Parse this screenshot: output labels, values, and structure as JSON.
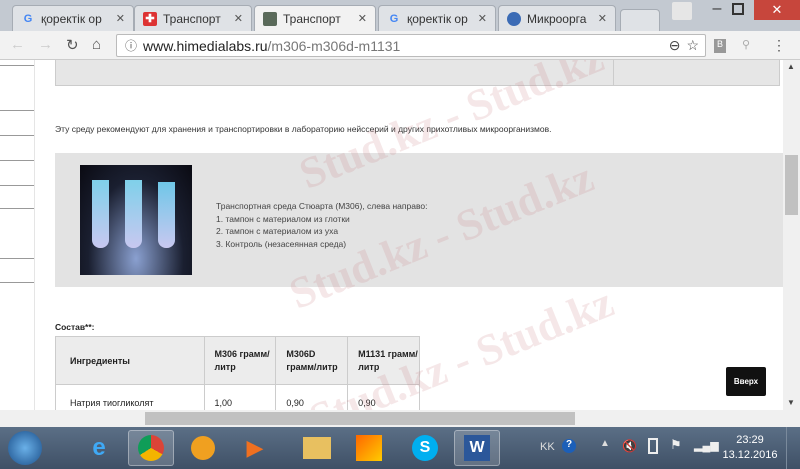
{
  "tabs": [
    {
      "label": "қоректік ор",
      "icon": "google-icon"
    },
    {
      "label": "Транспорт",
      "icon": "site-icon"
    },
    {
      "label": "Транспорт",
      "icon": "image-icon",
      "active": true
    },
    {
      "label": "қоректік ор",
      "icon": "google-icon"
    },
    {
      "label": "Микроорга",
      "icon": "globe-icon"
    }
  ],
  "url": {
    "host": "www.himedialabs.ru",
    "path": "/m306-m306d-m1131"
  },
  "page": {
    "intro": "Эту среду рекомендуют для хранения и транспортировки в лабораторию нейссерий и других прихотливых микроорганизмов.",
    "caption": [
      "Транспортная среда Стюарта (М306), слева направо:",
      "1. тампон с материалом из глотки",
      "2. тампон с материалом из уха",
      "3. Контроль (незасеянная среда)"
    ],
    "composition_label": "Состав**:",
    "table": {
      "headers": [
        "Ингредиенты",
        "M306 грамм/литр",
        "M306D грамм/литр",
        "M1131 грамм/литр"
      ],
      "rows": [
        [
          "Натрия тиогликолят",
          "1,00",
          "0,90",
          "0,90"
        ]
      ]
    },
    "top_button": "Вверх"
  },
  "watermark": "Stud.kz - Stud.kz",
  "tray": {
    "lang": "KK",
    "time": "23:29",
    "date": "13.12.2016"
  }
}
